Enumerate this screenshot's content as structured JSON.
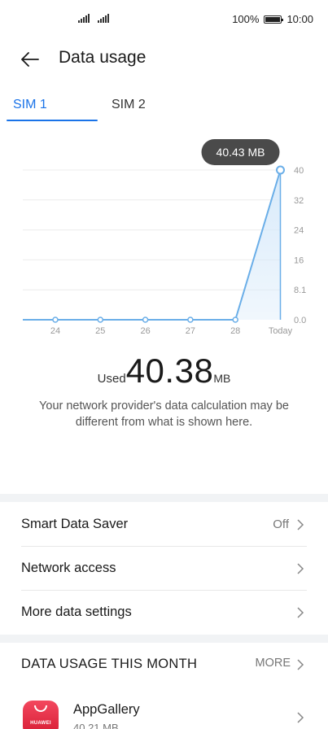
{
  "status_bar": {
    "battery_percent": "100%",
    "battery_level": 1.0,
    "time": "10:00"
  },
  "header": {
    "title": "Data usage",
    "back_icon": "arrow-left-icon"
  },
  "tabs": [
    {
      "label": "SIM 1",
      "selected": true
    },
    {
      "label": "SIM 2",
      "selected": false
    }
  ],
  "chart_data": {
    "type": "area",
    "x": [
      "24",
      "25",
      "26",
      "27",
      "28",
      "Today"
    ],
    "values": [
      0,
      0,
      0,
      0,
      0,
      40.43
    ],
    "y_ticks": [
      "40",
      "32",
      "24",
      "16",
      "8.1",
      "0.0"
    ],
    "ylim": [
      0,
      40.43
    ],
    "tooltip": "40.43 MB",
    "grid": true,
    "colors": {
      "line": "#6aaee8",
      "fill": "#d6e9fa",
      "tooltip_bg": "#4a4a4a"
    }
  },
  "usage": {
    "label": "Used",
    "value": "40.38",
    "unit": "MB"
  },
  "disclaimer": "Your network provider's data calculation may be different from what is shown here.",
  "settings": [
    {
      "label": "Smart Data Saver",
      "value": "Off"
    },
    {
      "label": "Network access",
      "value": ""
    },
    {
      "label": "More data settings",
      "value": ""
    }
  ],
  "month_section": {
    "title": "DATA USAGE THIS MONTH",
    "more_label": "MORE"
  },
  "apps": [
    {
      "name": "AppGallery",
      "usage": "40.21 MB",
      "icon_brand": "HUAWEI",
      "icon": "appgallery-icon"
    }
  ],
  "colors": {
    "accent": "#1a73e8"
  }
}
